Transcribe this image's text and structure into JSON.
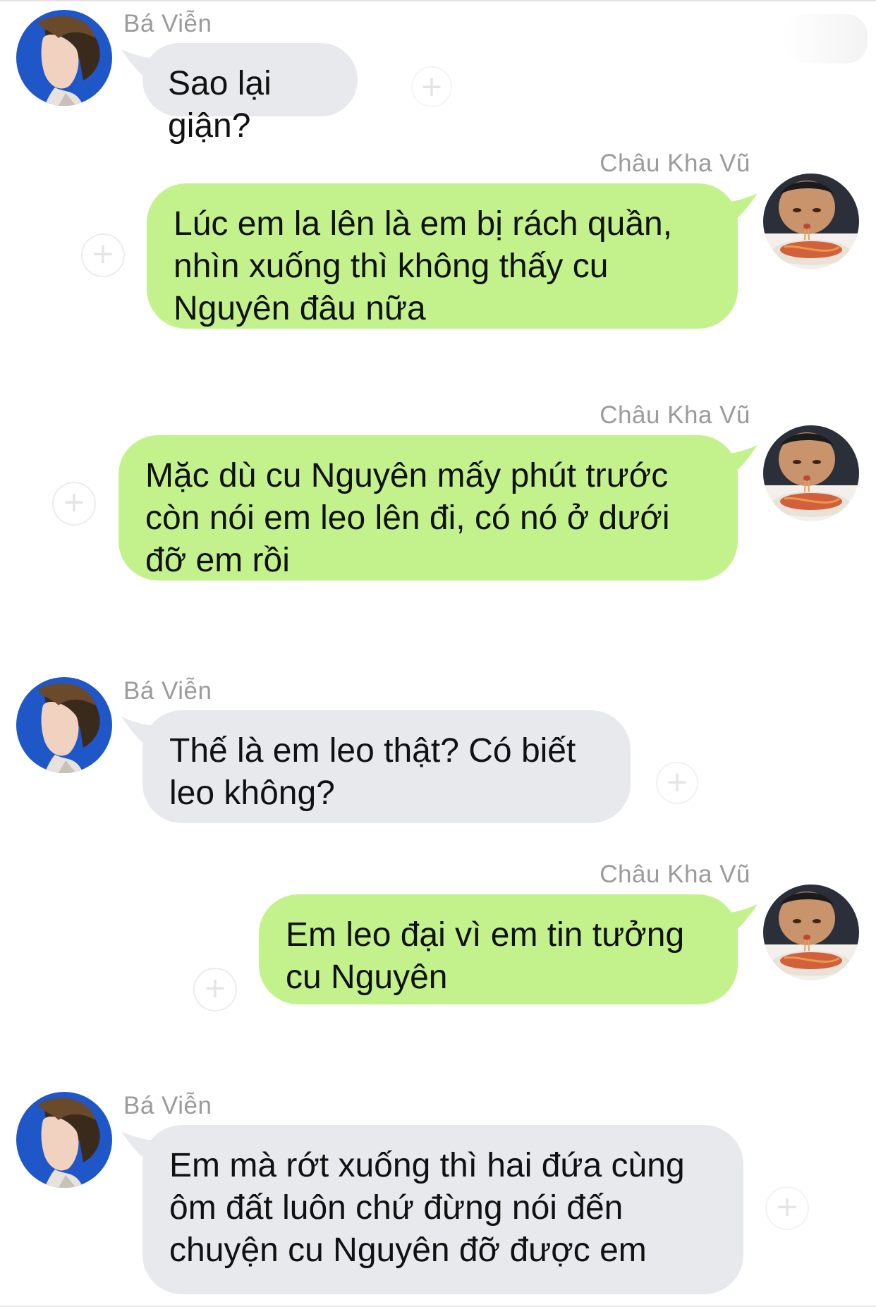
{
  "colors": {
    "incoming_bubble": "#e7e9ec",
    "outgoing_bubble": "#c3f28d",
    "name_text": "#9b9b9b",
    "message_text": "#111111",
    "avatar_bg_ba_vien": "#1f56c8"
  },
  "icons": {
    "reaction": "plus-circle-icon",
    "avatar_ba_vien": "avatar-ba-vien",
    "avatar_chau_kha_vu": "avatar-chau-kha-vu"
  },
  "messages": [
    {
      "sender": "Bá Viễn",
      "side": "left",
      "text": "Sao lại giận?"
    },
    {
      "sender": "Châu Kha Vũ",
      "side": "right",
      "text": "Lúc em la lên là em bị rách quần, nhìn xuống thì không thấy cu Nguyên đâu nữa"
    },
    {
      "sender": "Châu Kha Vũ",
      "side": "right",
      "text": "Mặc dù cu Nguyên mấy phút trước còn nói em leo lên đi, có nó ở dưới đỡ em rồi"
    },
    {
      "sender": "Bá Viễn",
      "side": "left",
      "text": "Thế là em leo thật? Có biết leo không?"
    },
    {
      "sender": "Châu Kha Vũ",
      "side": "right",
      "text": "Em leo đại vì em tin tưởng cu Nguyên"
    },
    {
      "sender": "Bá Viễn",
      "side": "left",
      "text": "Em mà rớt xuống thì hai đứa cùng ôm đất luôn chứ đừng nói đến chuyện cu Nguyên đỡ được em"
    }
  ],
  "reaction_glyph": "+"
}
